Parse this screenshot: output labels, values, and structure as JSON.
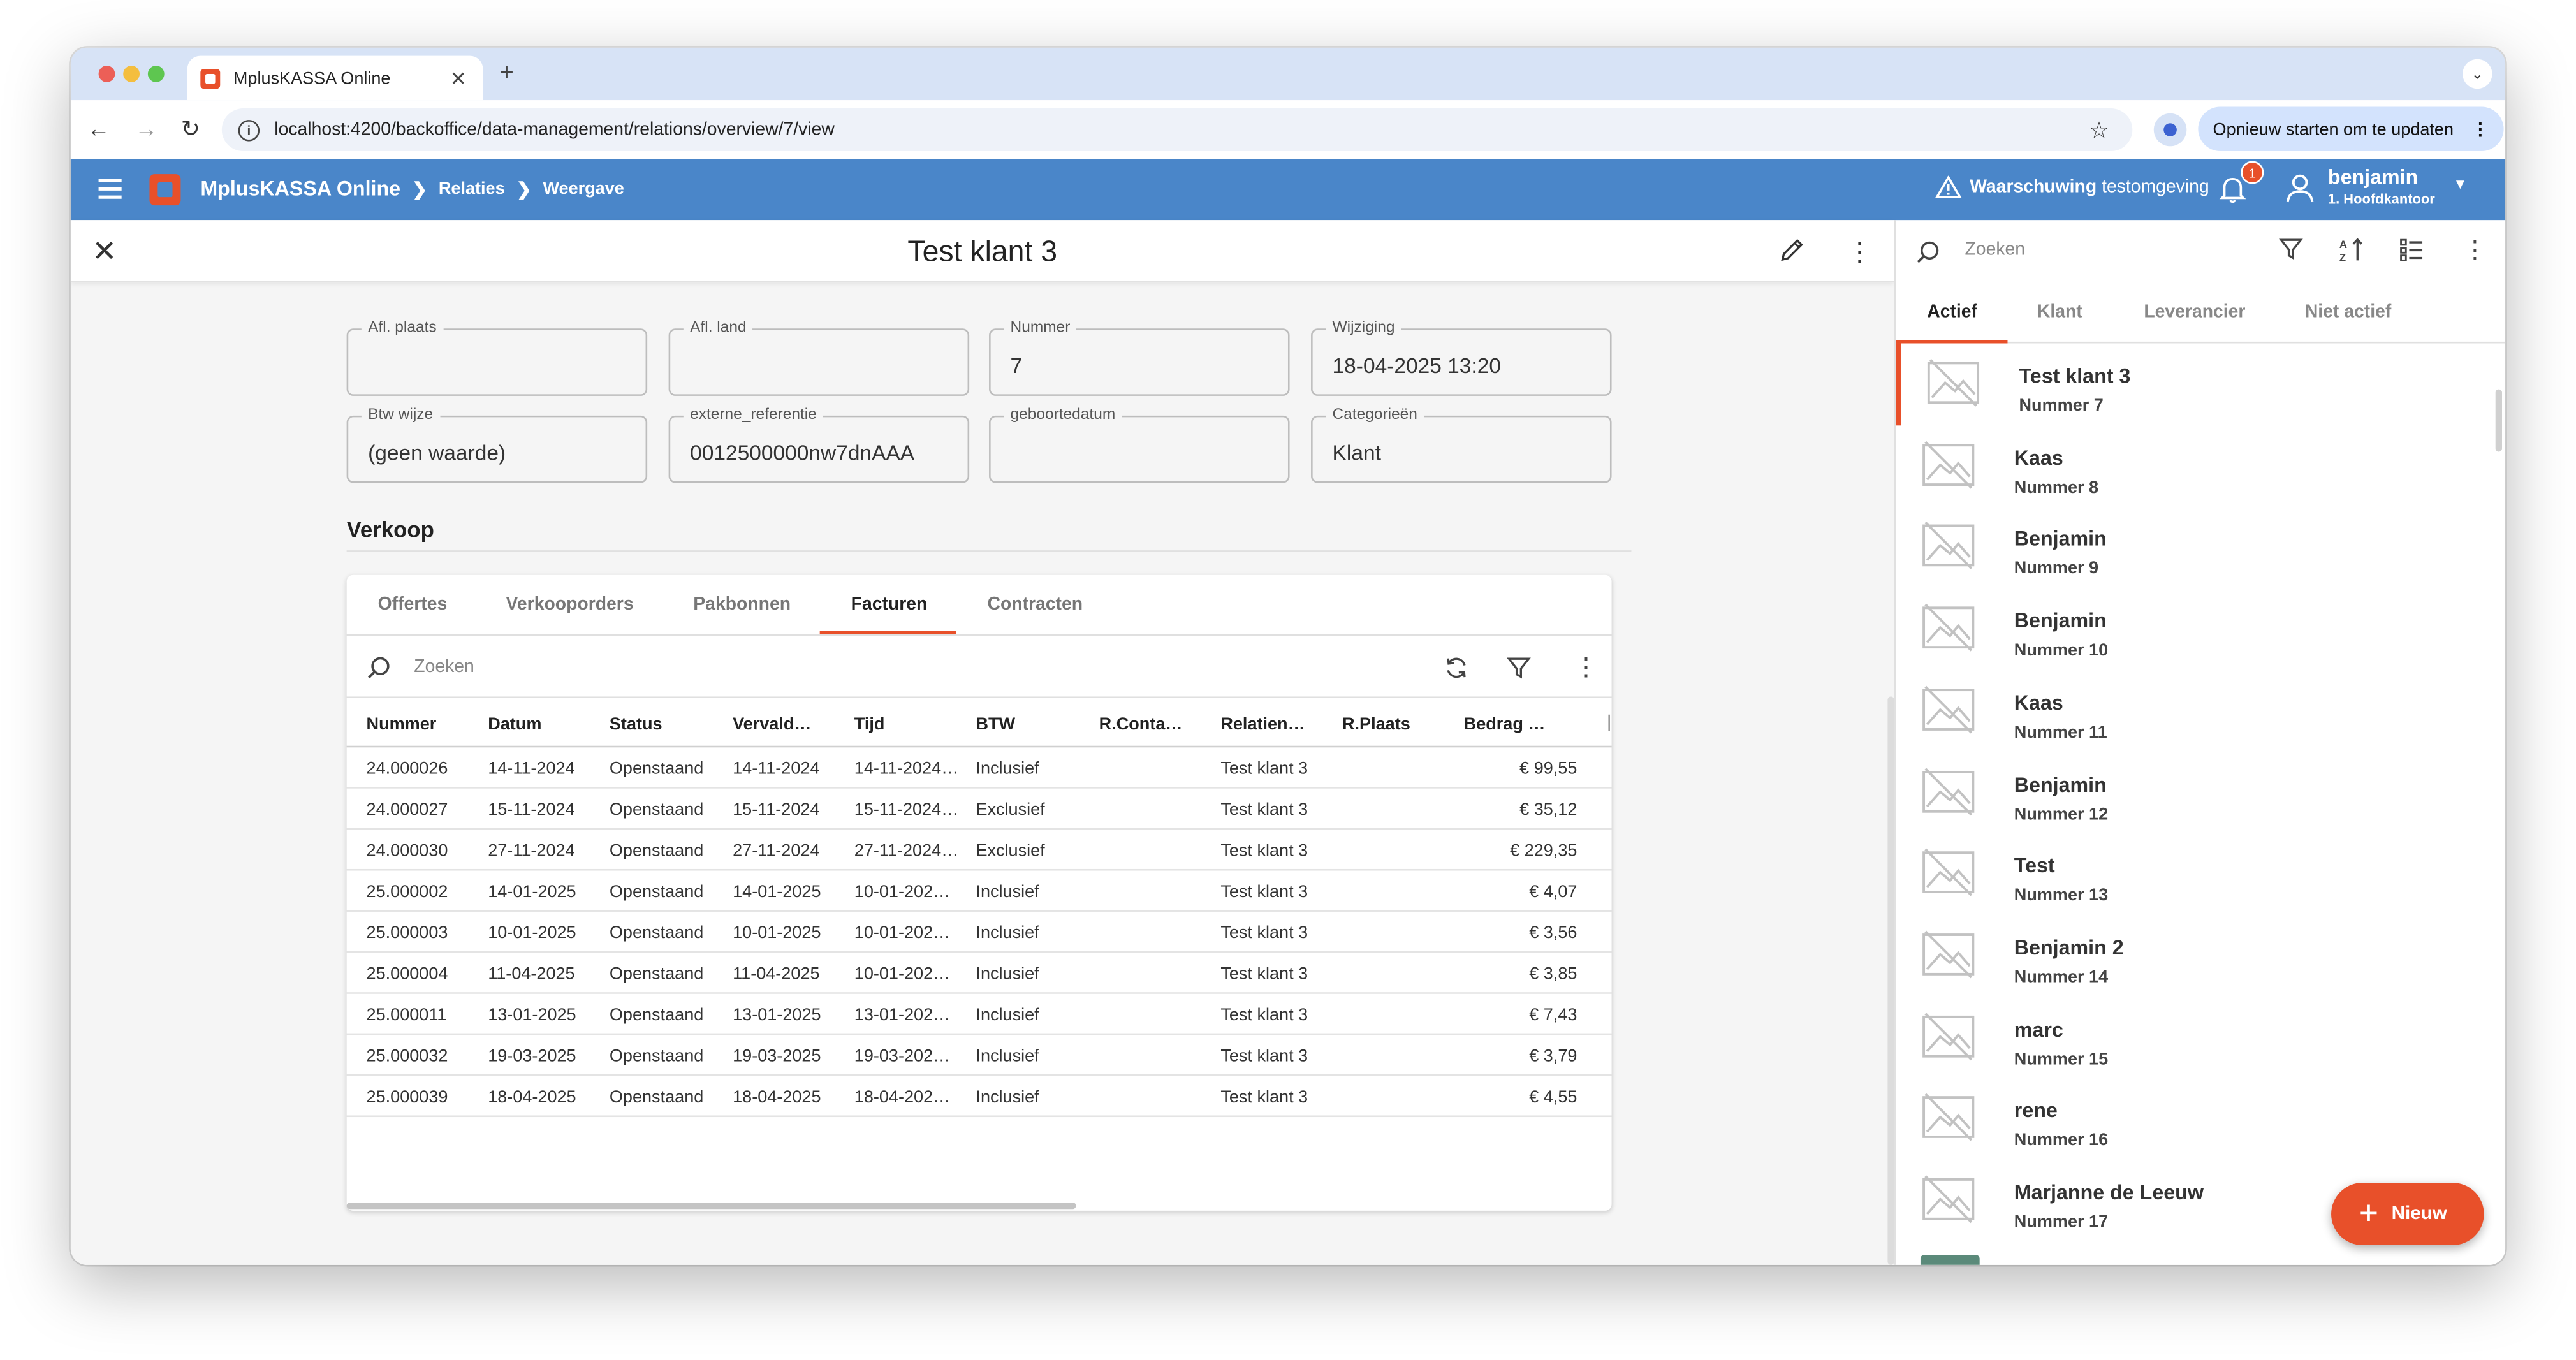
{
  "browser": {
    "tab_title": "MplusKASSA Online",
    "url": "localhost:4200/backoffice/data-management/relations/overview/7/view",
    "update_button": "Opnieuw starten om te updaten"
  },
  "appbar": {
    "brand": "MplusKASSA Online",
    "breadcrumbs": [
      "Relaties",
      "Weergave"
    ],
    "warning": "Waarschuwing",
    "warning_suffix": "testomgeving",
    "notification_count": "1",
    "user_name": "benjamin",
    "user_location": "1. Hoofdkantoor",
    "colors": {
      "appbar": "#4a86c9",
      "accent": "#e8502a"
    }
  },
  "detail": {
    "title": "Test klant 3",
    "fields_row1": [
      {
        "label": "Afl. plaats",
        "value": ""
      },
      {
        "label": "Afl. land",
        "value": ""
      },
      {
        "label": "Nummer",
        "value": "7"
      },
      {
        "label": "Wijziging",
        "value": "18-04-2025 13:20"
      }
    ],
    "fields_row2": [
      {
        "label": "Btw wijze",
        "value": "(geen waarde)"
      },
      {
        "label": "externe_referentie",
        "value": "0012500000nw7dnAAA"
      },
      {
        "label": "geboortedatum",
        "value": ""
      },
      {
        "label": "Categorieën",
        "value": "Klant"
      }
    ],
    "section_title": "Verkoop",
    "sub_tabs": [
      "Offertes",
      "Verkooporders",
      "Pakbonnen",
      "Facturen",
      "Contracten"
    ],
    "active_sub_tab": "Facturen",
    "search_placeholder": "Zoeken",
    "columns": [
      "Nummer",
      "Datum",
      "Status",
      "Vervald…",
      "Tijd",
      "BTW",
      "R.Conta…",
      "Relatien…",
      "R.Plaats",
      "Bedrag …"
    ],
    "rows": [
      [
        "24.000026",
        "14-11-2024",
        "Openstaand",
        "14-11-2024",
        "14-11-2024…",
        "Inclusief",
        "",
        "Test klant 3",
        "",
        "€ 99,55"
      ],
      [
        "24.000027",
        "15-11-2024",
        "Openstaand",
        "15-11-2024",
        "15-11-2024…",
        "Exclusief",
        "",
        "Test klant 3",
        "",
        "€ 35,12"
      ],
      [
        "24.000030",
        "27-11-2024",
        "Openstaand",
        "27-11-2024",
        "27-11-2024…",
        "Exclusief",
        "",
        "Test klant 3",
        "",
        "€ 229,35"
      ],
      [
        "25.000002",
        "14-01-2025",
        "Openstaand",
        "14-01-2025",
        "10-01-202…",
        "Inclusief",
        "",
        "Test klant 3",
        "",
        "€ 4,07"
      ],
      [
        "25.000003",
        "10-01-2025",
        "Openstaand",
        "10-01-2025",
        "10-01-202…",
        "Inclusief",
        "",
        "Test klant 3",
        "",
        "€ 3,56"
      ],
      [
        "25.000004",
        "11-04-2025",
        "Openstaand",
        "11-04-2025",
        "10-01-202…",
        "Inclusief",
        "",
        "Test klant 3",
        "",
        "€ 3,85"
      ],
      [
        "25.000011",
        "13-01-2025",
        "Openstaand",
        "13-01-2025",
        "13-01-202…",
        "Inclusief",
        "",
        "Test klant 3",
        "",
        "€ 7,43"
      ],
      [
        "25.000032",
        "19-03-2025",
        "Openstaand",
        "19-03-2025",
        "19-03-202…",
        "Inclusief",
        "",
        "Test klant 3",
        "",
        "€ 3,79"
      ],
      [
        "25.000039",
        "18-04-2025",
        "Openstaand",
        "18-04-2025",
        "18-04-202…",
        "Inclusief",
        "",
        "Test klant 3",
        "",
        "€ 4,55"
      ]
    ]
  },
  "sidebar": {
    "search_placeholder": "Zoeken",
    "tabs": [
      "Actief",
      "Klant",
      "Leverancier",
      "Niet actief"
    ],
    "active_tab": "Actief",
    "items": [
      {
        "name": "Test klant 3",
        "number": "Nummer 7"
      },
      {
        "name": "Kaas",
        "number": "Nummer 8"
      },
      {
        "name": "Benjamin",
        "number": "Nummer 9"
      },
      {
        "name": "Benjamin",
        "number": "Nummer 10"
      },
      {
        "name": "Kaas",
        "number": "Nummer 11"
      },
      {
        "name": "Benjamin",
        "number": "Nummer 12"
      },
      {
        "name": "Test",
        "number": "Nummer 13"
      },
      {
        "name": "Benjamin 2",
        "number": "Nummer 14"
      },
      {
        "name": "marc",
        "number": "Nummer 15"
      },
      {
        "name": "rene",
        "number": "Nummer 16"
      },
      {
        "name": "Marjanne de Leeuw",
        "number": "Nummer 17"
      }
    ],
    "new_button": "Nieuw"
  }
}
